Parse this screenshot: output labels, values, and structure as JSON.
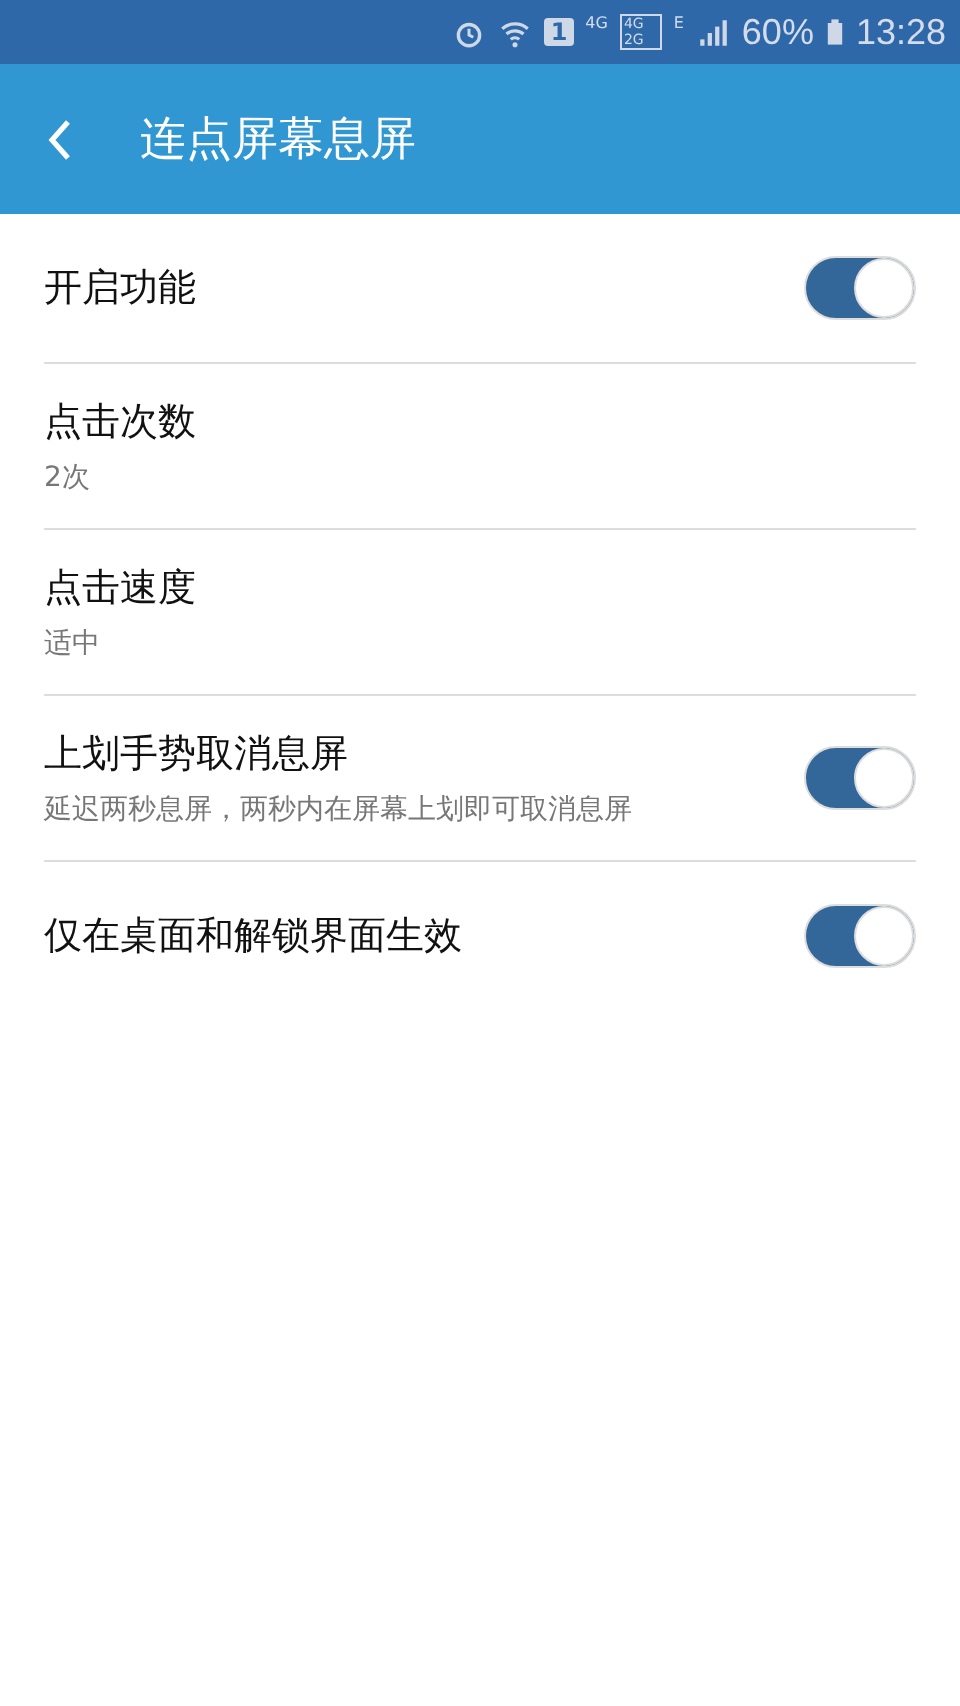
{
  "status_bar": {
    "sim": "1",
    "net_4g": "4G",
    "box_4g": "4G",
    "box_2g": "2G",
    "net_e": "E",
    "battery": "60%",
    "time": "13:28"
  },
  "header": {
    "title": "连点屏幕息屏"
  },
  "settings": [
    {
      "title": "开启功能",
      "kind": "toggle",
      "on": true
    },
    {
      "title": "点击次数",
      "subtitle": "2次",
      "kind": "value"
    },
    {
      "title": "点击速度",
      "subtitle": "适中",
      "kind": "value"
    },
    {
      "title": "上划手势取消息屏",
      "subtitle": "延迟两秒息屏，两秒内在屏幕上划即可取消息屏",
      "kind": "toggle",
      "on": true
    },
    {
      "title": "仅在桌面和解锁界面生效",
      "kind": "toggle",
      "on": true
    }
  ]
}
